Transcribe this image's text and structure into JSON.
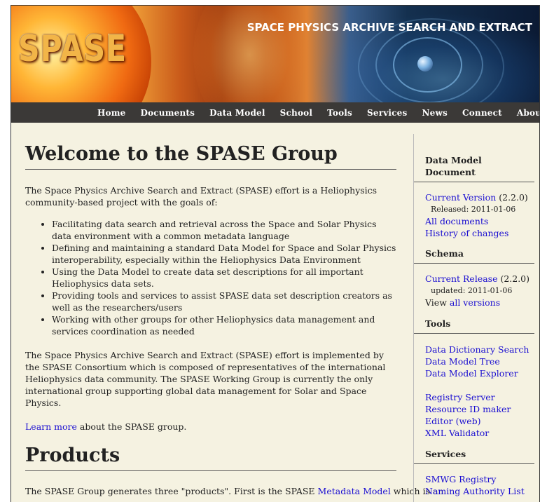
{
  "banner": {
    "logo_text": "SPASE",
    "title": "SPACE PHYSICS ARCHIVE SEARCH AND EXTRACT"
  },
  "nav": {
    "items": [
      "Home",
      "Documents",
      "Data Model",
      "School",
      "Tools",
      "Services",
      "News",
      "Connect",
      "About"
    ]
  },
  "main": {
    "heading": "Welcome to the SPASE Group",
    "intro": "The Space Physics Archive Search and Extract (SPASE) effort is a Heliophysics community-based project with the goals of:",
    "goals": [
      "Facilitating data search and retrieval across the Space and Solar Physics data environment with a common metadata language",
      "Defining and maintaining a standard Data Model for Space and Solar Physics interoperability, especially within the Heliophysics Data Environment",
      "Using the Data Model to create data set descriptions for all important Heliophysics data sets.",
      "Providing tools and services to assist SPASE data set description creators as well as the researchers/users",
      "Working with other groups for other Heliophysics data management and services coordination as needed"
    ],
    "consortium": "The Space Physics Archive Search and Extract (SPASE) effort is implemented by the SPASE Consortium which is composed of representatives of the international Heliophysics data community. The SPASE Working Group is currently the only international group supporting global data management for Solar and Space Physics.",
    "learn_more_link": "Learn more",
    "learn_more_rest": " about the SPASE group.",
    "products_heading": "Products",
    "products_text_before": "The SPASE Group generates three \"products\". First is the SPASE ",
    "products_link": "Metadata Model",
    "products_text_after": " which is an"
  },
  "sidebar": {
    "data_model_doc": {
      "heading": "Data Model Document",
      "current_link": "Current Version",
      "current_version": " (2.2.0)",
      "released": "Released: 2011-01-06",
      "all_docs": "All documents",
      "history": "History of changes"
    },
    "schema": {
      "heading": "Schema",
      "current_link": "Current Release",
      "current_version": " (2.2.0)",
      "updated": "updated: 2011-01-06",
      "view_prefix": "View ",
      "all_versions": "all versions"
    },
    "tools": {
      "heading": "Tools",
      "group1": [
        "Data Dictionary Search",
        "Data Model Tree",
        "Data Model Explorer"
      ],
      "group2": [
        "Registry Server",
        "Resource ID maker",
        "Editor (web)",
        "XML Validator"
      ]
    },
    "services": {
      "heading": "Services",
      "items": [
        "SMWG Registry",
        "Naming Authority List"
      ]
    }
  }
}
